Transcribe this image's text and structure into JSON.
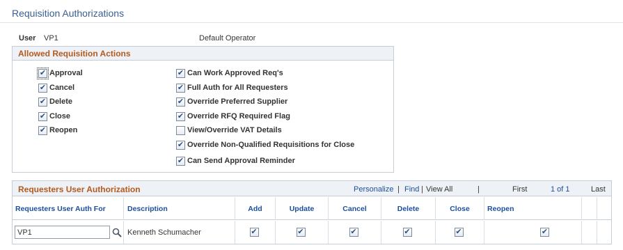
{
  "page": {
    "title": "Requisition Authorizations",
    "user_label": "User",
    "user_value": "VP1",
    "operator_desc": "Default Operator"
  },
  "allowed_actions": {
    "header": "Allowed Requisition Actions",
    "left": [
      {
        "label": "Approval",
        "checked": true
      },
      {
        "label": "Cancel",
        "checked": true
      },
      {
        "label": "Delete",
        "checked": true
      },
      {
        "label": "Close",
        "checked": true
      },
      {
        "label": "Reopen",
        "checked": true
      }
    ],
    "right": [
      {
        "label": "Can Work Approved Req's",
        "checked": true
      },
      {
        "label": "Full Auth for All Requesters",
        "checked": true
      },
      {
        "label": "Override Preferred Supplier",
        "checked": true
      },
      {
        "label": "Override RFQ Required Flag",
        "checked": true
      },
      {
        "label": "View/Override VAT Details",
        "checked": false
      },
      {
        "label": "Override Non-Qualified Requisitions for Close",
        "checked": true
      },
      {
        "label": "Can Send Approval Reminder",
        "checked": true
      }
    ]
  },
  "grid": {
    "title": "Requesters User Authorization",
    "personalize": "Personalize",
    "sep1": "|",
    "find": "Find",
    "sep2": "|",
    "view_all": "View All",
    "sep3": "|",
    "first": "First",
    "page_info": "1 of 1",
    "last": "Last",
    "columns": [
      "Requesters User Auth For",
      "Description",
      "Add",
      "Update",
      "Cancel",
      "Delete",
      "Close",
      "Reopen"
    ],
    "rows": [
      {
        "auth_for": "VP1",
        "description": "Kenneth Schumacher",
        "add": true,
        "update": true,
        "cancel": true,
        "delete": true,
        "close": true,
        "reopen": true
      }
    ]
  },
  "colors": {
    "section_header": "#b35a1f",
    "link": "#1b4f9c",
    "title": "#3a5f8f"
  }
}
